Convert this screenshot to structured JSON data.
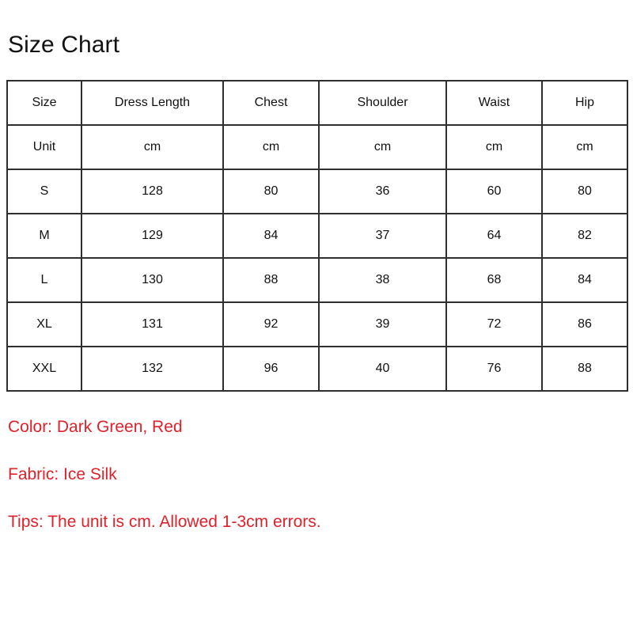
{
  "title": "Size Chart",
  "table": {
    "columns": [
      "Size",
      "Dress Length",
      "Chest",
      "Shoulder",
      "Waist",
      "Hip"
    ],
    "unit_row": [
      "Unit",
      "cm",
      "cm",
      "cm",
      "cm",
      "cm"
    ],
    "rows": [
      [
        "S",
        "128",
        "80",
        "36",
        "60",
        "80"
      ],
      [
        "M",
        "129",
        "84",
        "37",
        "64",
        "82"
      ],
      [
        "L",
        "130",
        "88",
        "38",
        "68",
        "84"
      ],
      [
        "XL",
        "131",
        "92",
        "39",
        "72",
        "86"
      ],
      [
        "XXL",
        "132",
        "96",
        "40",
        "76",
        "88"
      ]
    ]
  },
  "notes": {
    "color": "Color: Dark Green, Red",
    "fabric": "Fabric: Ice Silk",
    "tips": "Tips: The unit is cm. Allowed 1-3cm errors."
  },
  "colors": {
    "note_text": "#e0212b",
    "table_border": "#2e2e2e",
    "cell_text": "#111111",
    "title_text": "#121212",
    "background": "#ffffff"
  }
}
